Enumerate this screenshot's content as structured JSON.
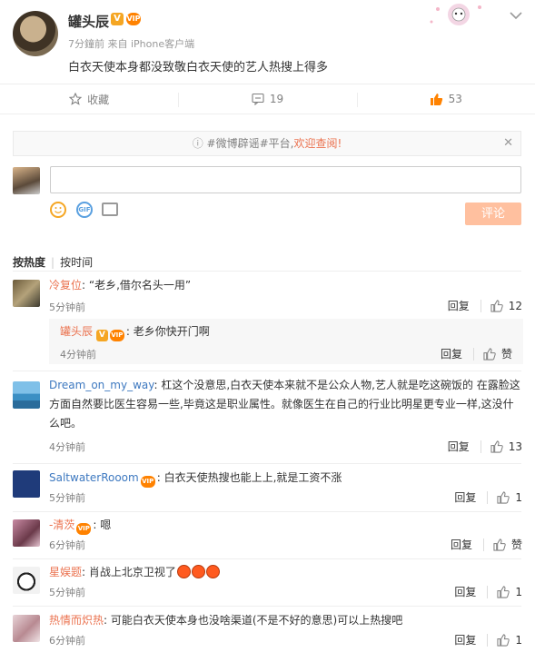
{
  "post": {
    "author": "罐头辰",
    "badge_v": "V",
    "badge_vip": "VIP",
    "meta": "7分鐘前 来自 iPhone客户端",
    "text": "白衣天使本身都没致敬白衣天使的艺人热搜上得多"
  },
  "actions": {
    "favorite_label": "收藏",
    "comment_count": "19",
    "like_count": "53"
  },
  "notice": {
    "prefix": "#微博辟谣#平台,",
    "highlight": "欢迎查阅!",
    "close": "✕"
  },
  "composer": {
    "placeholder": "",
    "submit_label": "评论",
    "gif_label": "GIF"
  },
  "sort": {
    "active": "按热度",
    "other": "按时间"
  },
  "comments": [
    {
      "user": "冷复位",
      "text": ": “老乡,借尔名头一用”",
      "time": "5分钟前",
      "reply_label": "回复",
      "likes": "12",
      "sub": {
        "user": "罐头辰",
        "text": ": 老乡你快开门啊",
        "time": "4分钟前",
        "reply_label": "回复",
        "like_label": "赞"
      }
    },
    {
      "user": "Dream_on_my_way",
      "text": ": 杠这个没意思,白衣天使本来就不是公众人物,艺人就是吃这碗饭的 在露脸这方面自然要比医生容易一些,毕竟这是职业属性。就像医生在自己的行业比明星更专业一样,这没什么吧。",
      "time": "4分钟前",
      "reply_label": "回复",
      "likes": "13"
    },
    {
      "user": "SaltwaterRooom",
      "text": ": 白衣天使热搜也能上上,就是工资不涨",
      "time": "5分钟前",
      "reply_label": "回复",
      "likes": "1"
    },
    {
      "user": "-清茨",
      "text": ": 嗯",
      "time": "6分钟前",
      "reply_label": "回复",
      "like_label": "赞"
    },
    {
      "user": "星娱题",
      "text": ": 肖战上北京卫视了",
      "time": "5分钟前",
      "reply_label": "回复",
      "likes": "1"
    },
    {
      "user": "热情而炽热",
      "text": ": 可能白衣天使本身也没啥渠道(不是不好的意思)可以上热搜吧",
      "time": "6分钟前",
      "reply_label": "回复",
      "likes": "1"
    }
  ],
  "colors": {
    "accent": "#eb7350",
    "link_blue": "#3e79c0",
    "like_orange": "#ff8200"
  }
}
